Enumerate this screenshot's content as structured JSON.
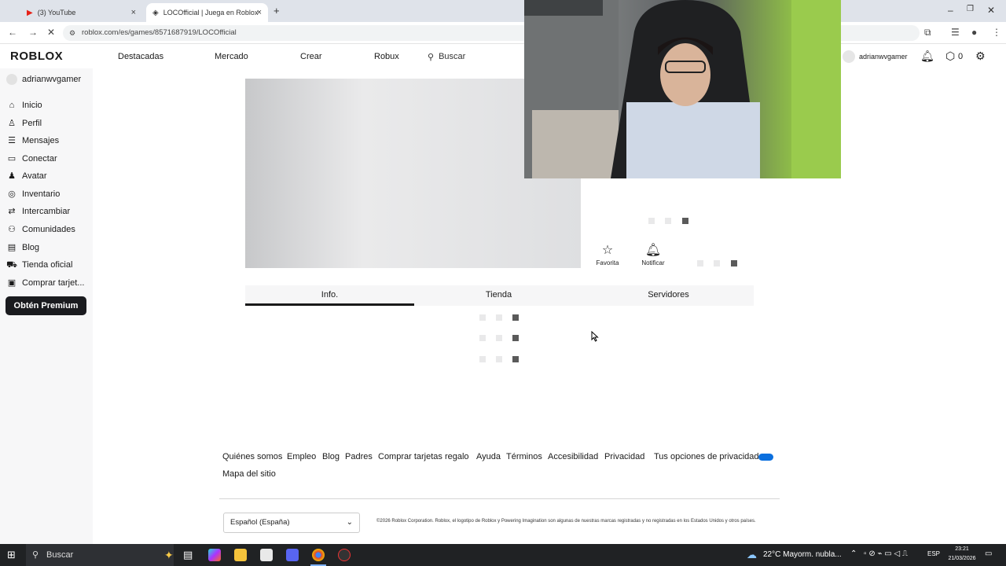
{
  "browser": {
    "tabs": [
      {
        "title": "(3) YouTube",
        "active": false
      },
      {
        "title": "LOCOfficial | Juega en Roblox",
        "active": true
      }
    ],
    "url": "roblox.com/es/games/8571687919/LOCOfficial",
    "new_tab": "+"
  },
  "header": {
    "logo": "ROBLOX",
    "nav": [
      "Destacadas",
      "Mercado",
      "Crear",
      "Robux"
    ],
    "search_placeholder": "Buscar",
    "username": "adrianwvgamer",
    "robux_count": "0"
  },
  "sidebar": {
    "user": "adrianwvgamer",
    "items": [
      {
        "label": "Inicio",
        "icon": "home-icon"
      },
      {
        "label": "Perfil",
        "icon": "profile-icon"
      },
      {
        "label": "Mensajes",
        "icon": "messages-icon"
      },
      {
        "label": "Conectar",
        "icon": "connect-icon"
      },
      {
        "label": "Avatar",
        "icon": "avatar-icon"
      },
      {
        "label": "Inventario",
        "icon": "inventory-icon"
      },
      {
        "label": "Intercambiar",
        "icon": "trade-icon"
      },
      {
        "label": "Comunidades",
        "icon": "communities-icon"
      },
      {
        "label": "Blog",
        "icon": "blog-icon"
      },
      {
        "label": "Tienda oficial",
        "icon": "store-icon"
      },
      {
        "label": "Comprar tarjet...",
        "icon": "giftcard-icon"
      }
    ],
    "premium_button": "Obtén Premium"
  },
  "game": {
    "actions": [
      {
        "label": "Favorita",
        "icon": "star-icon"
      },
      {
        "label": "Notificar",
        "icon": "bell-icon"
      }
    ],
    "tabs": [
      "Info.",
      "Tienda",
      "Servidores"
    ],
    "active_tab": "Info."
  },
  "footer": {
    "links": [
      "Quiénes somos",
      "Empleo",
      "Blog",
      "Padres",
      "Comprar tarjetas regalo",
      "Ayuda",
      "Términos",
      "Accesibilidad",
      "Privacidad",
      "Tus opciones de privacidad",
      "Mapa del sitio"
    ],
    "language": "Español (España)",
    "copyright": "©2026 Roblox Corporation. Roblox, el logotipo de Roblox y Powering Imagination son algunas de nuestras marcas registradas y no registradas en los Estados Unidos y otros países."
  },
  "taskbar": {
    "search": "Buscar",
    "weather": "22°C  Mayorm. nubla...",
    "language": "ESP",
    "time": "23:21",
    "date": "21/03/2026"
  },
  "colors": {
    "premium_bg": "#1a1b1f",
    "sidebar_bg": "#f7f7f8",
    "taskbar_bg": "#202224",
    "loader_dark": "#5a5a5a"
  }
}
